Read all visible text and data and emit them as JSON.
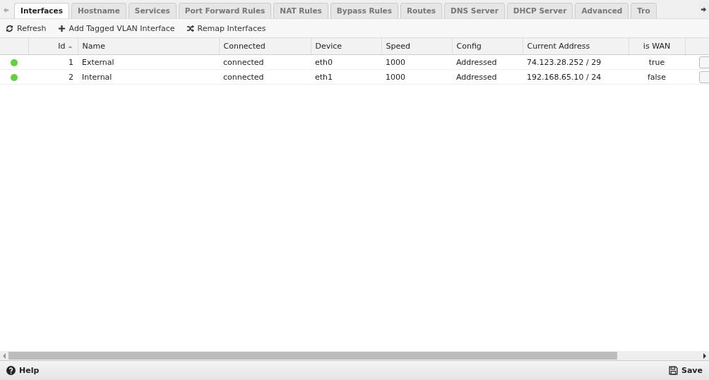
{
  "tabs": [
    {
      "label": "Interfaces",
      "selected": true
    },
    {
      "label": "Hostname",
      "selected": false
    },
    {
      "label": "Services",
      "selected": false
    },
    {
      "label": "Port Forward Rules",
      "selected": false
    },
    {
      "label": "NAT Rules",
      "selected": false
    },
    {
      "label": "Bypass Rules",
      "selected": false
    },
    {
      "label": "Routes",
      "selected": false
    },
    {
      "label": "DNS Server",
      "selected": false
    },
    {
      "label": "DHCP Server",
      "selected": false
    },
    {
      "label": "Advanced",
      "selected": false
    },
    {
      "label": "Tro",
      "selected": false
    }
  ],
  "toolbar": [
    {
      "kind": "refresh",
      "label": "Refresh"
    },
    {
      "kind": "add",
      "label": "Add Tagged VLAN Interface"
    },
    {
      "kind": "remap",
      "label": "Remap Interfaces"
    }
  ],
  "table": {
    "columns": [
      {
        "label": "Id",
        "sorted": true
      },
      {
        "label": "Name",
        "sorted": false
      },
      {
        "label": "Connected",
        "sorted": false
      },
      {
        "label": "Device",
        "sorted": false
      },
      {
        "label": "Speed",
        "sorted": false
      },
      {
        "label": "Config",
        "sorted": false
      },
      {
        "label": "Current Address",
        "sorted": false
      },
      {
        "label": "is WAN",
        "sorted": false
      }
    ],
    "rows": [
      {
        "color": "#5fd13b",
        "cells": [
          "1",
          "External",
          "connected",
          "eth0",
          "1000",
          "Addressed",
          "74.123.28.252 / 29",
          "true"
        ]
      },
      {
        "color": "#5fd13b",
        "cells": [
          "2",
          "Internal",
          "connected",
          "eth1",
          "1000",
          "Addressed",
          "192.168.65.10 / 24",
          "false"
        ]
      }
    ]
  },
  "footer": {
    "help": "Help",
    "save": "Save"
  }
}
